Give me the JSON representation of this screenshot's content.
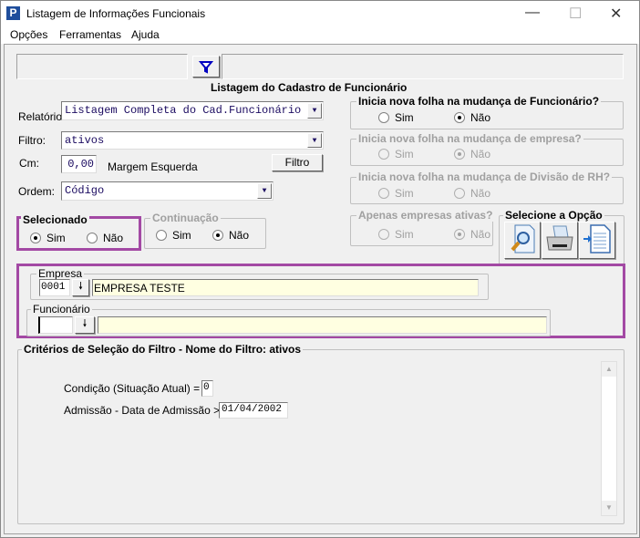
{
  "window": {
    "title": "Listagem de Informações Funcionais",
    "app_icon": "P",
    "minimize": "—",
    "maximize": "☐",
    "close": "✕"
  },
  "menu": [
    "Opções",
    "Ferramentas",
    "Ajuda"
  ],
  "header": {
    "title": "Listagem do Cadastro de Funcionário",
    "filter_icon": "funnel-icon"
  },
  "form": {
    "relatorio_label": "Relatório",
    "relatorio_value": "Listagem Completa do Cad.Funcionário",
    "filtro_label": "Filtro:",
    "filtro_value": "ativos",
    "cm_label": "Cm:",
    "cm_value": "0,00",
    "margem_label": "Margem Esquerda",
    "filtro_button": "Filtro",
    "ordem_label": "Ordem:",
    "ordem_value": "Código"
  },
  "selecionado": {
    "title": "Selecionado",
    "sim": "Sim",
    "nao": "Não",
    "selected": "Sim"
  },
  "continuacao": {
    "title": "Continuação",
    "sim": "Sim",
    "nao": "Não",
    "selected": "Não"
  },
  "groups": [
    {
      "title": "Inicia nova folha na mudança de Funcionário?",
      "sim": "Sim",
      "nao": "Não",
      "selected": "Não",
      "enabled": true
    },
    {
      "title": "Inicia nova folha na mudança de empresa?",
      "sim": "Sim",
      "nao": "Não",
      "selected": "Não",
      "enabled": false
    },
    {
      "title": "Inicia nova folha na mudança de Divisão de RH?",
      "sim": "Sim",
      "nao": "Não",
      "selected": "",
      "enabled": false
    },
    {
      "title": "Apenas empresas ativas?",
      "sim": "Sim",
      "nao": "Não",
      "selected": "Não",
      "enabled": false
    }
  ],
  "opcao": {
    "title": "Selecione a Opção",
    "buttons": [
      "preview-icon",
      "printer-icon",
      "export-file-icon"
    ]
  },
  "empresa": {
    "title": "Empresa",
    "code": "0001",
    "name": "EMPRESA TESTE"
  },
  "funcionario": {
    "title": "Funcionário",
    "code": "",
    "name": ""
  },
  "criterios": {
    "title": "Critérios de Seleção do Filtro - Nome do Filtro: ativos",
    "cond_label": "Condição (Situação Atual) =",
    "cond_value": "0",
    "adm_label": "Admissão - Data de Admissão >=",
    "adm_value": "01/04/2002"
  }
}
